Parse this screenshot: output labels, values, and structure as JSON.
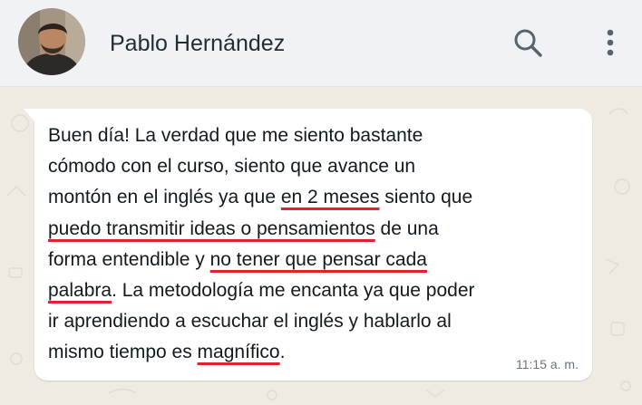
{
  "header": {
    "contact_name": "Pablo Hernández",
    "avatar_icon": "contact-avatar",
    "search_icon": "search-icon",
    "menu_icon": "kebab-menu-icon"
  },
  "message": {
    "segments": [
      "Buen día! La verdad que me siento bastante\ncómodo con el curso, siento que avance un\nmontón en el inglés ya que ",
      "en 2 meses",
      " siento que\n",
      "puedo transmitir ideas o pensamientos",
      " de una\nforma entendible y ",
      "no tener que pensar cada\npalabra",
      ". La metodología me encanta ya que poder\nir aprendiendo a escuchar el inglés y hablarlo al\nmismo tiempo es ",
      "magnífico",
      "."
    ],
    "time": "11:15 a. m."
  },
  "colors": {
    "header_bg": "#f0f2f5",
    "chat_bg": "#efeae2",
    "bubble_bg": "#ffffff",
    "highlight_underline": "#e0222f",
    "timestamp": "#667781"
  }
}
